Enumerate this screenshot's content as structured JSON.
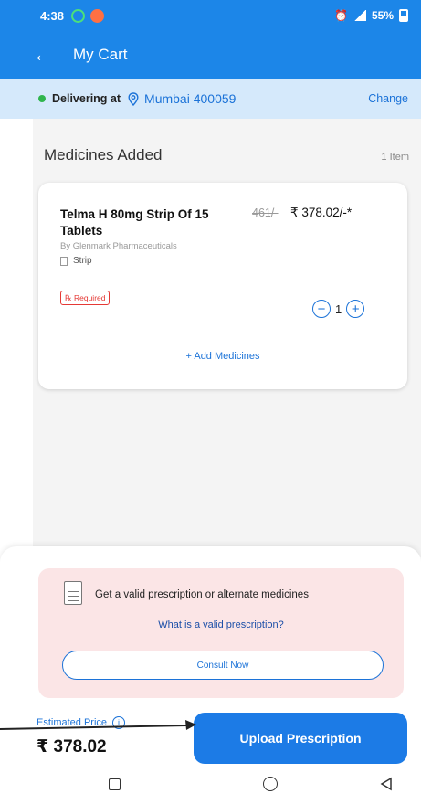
{
  "status": {
    "time": "4:38",
    "battery": "55%"
  },
  "appbar": {
    "title": "My Cart"
  },
  "delivery": {
    "label": "Delivering at",
    "city": "Mumbai 400059",
    "change": "Change"
  },
  "cart": {
    "section_title": "Medicines Added",
    "item_count": "1 Item",
    "item": {
      "name": "Telma H 80mg Strip Of 15 Tablets",
      "mrp": "461/-",
      "price": "₹ 378.02/-*",
      "manufacturer": "By Glenmark Pharmaceuticals",
      "pack": "Strip",
      "rx_badge": "℞ Required",
      "quantity": "1"
    },
    "add_medicines": "+ Add Medicines"
  },
  "prescription": {
    "text": "Get a valid prescription or alternate medicines",
    "link": "What is a valid prescription?",
    "consult": "Consult Now"
  },
  "footer": {
    "est_label": "Estimated Price",
    "est_price": "₹ 378.02",
    "upload": "Upload Prescription"
  },
  "colors": {
    "primary": "#1c86e8",
    "accent_blue": "#1c73d8",
    "rx_red": "#e53935",
    "panel_pink": "#fbe5e6"
  },
  "icons": [
    "back-arrow-icon",
    "location-pin-icon",
    "info-icon",
    "prescription-doc-icon",
    "minus-icon",
    "plus-icon"
  ]
}
